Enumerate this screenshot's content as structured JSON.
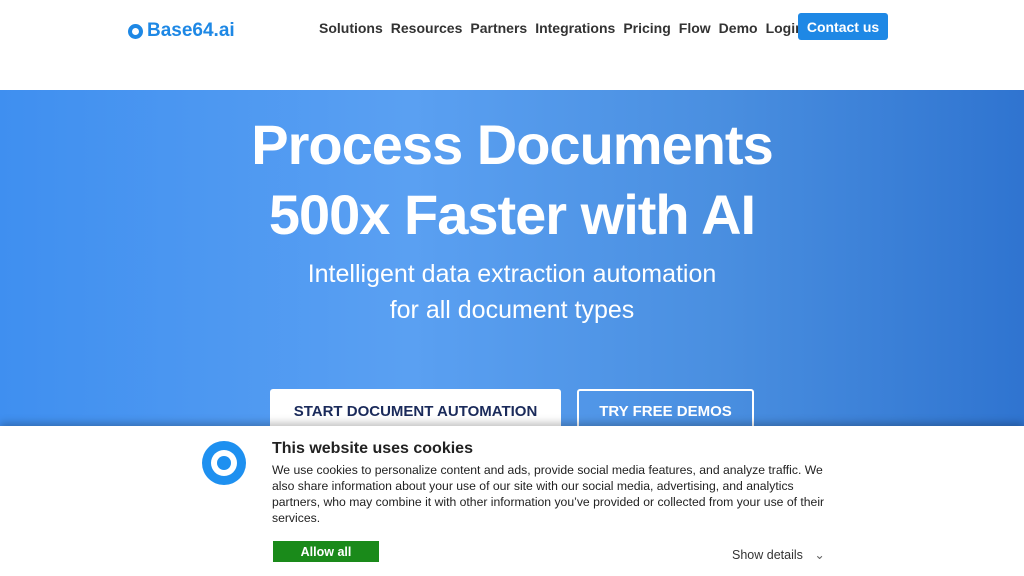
{
  "nav": {
    "logo": "Base64.ai",
    "items": [
      "Solutions",
      "Resources",
      "Partners",
      "Integrations",
      "Pricing",
      "Flow",
      "Demo",
      "Login"
    ],
    "contact": "Contact us"
  },
  "hero": {
    "title_line1": "Process Documents",
    "title_line2": "500x Faster with AI",
    "subtitle_line1": "Intelligent data extraction automation",
    "subtitle_line2": "for all document types",
    "cta_primary": "START DOCUMENT AUTOMATION",
    "cta_secondary": "TRY FREE DEMOS"
  },
  "cookie": {
    "title": "This website uses cookies",
    "text": "We use cookies to personalize content and ads, provide social media features, and analyze traffic. We also share information about your use of our site with our social media, advertising, and analytics partners, who may combine it with other information you’ve provided or collected from your use of their services.",
    "allow": "Allow all",
    "details": "Show details",
    "details_icon": "chevron-down-icon"
  },
  "colors": {
    "brand": "#1e88e5",
    "allow": "#1a8a1a"
  }
}
